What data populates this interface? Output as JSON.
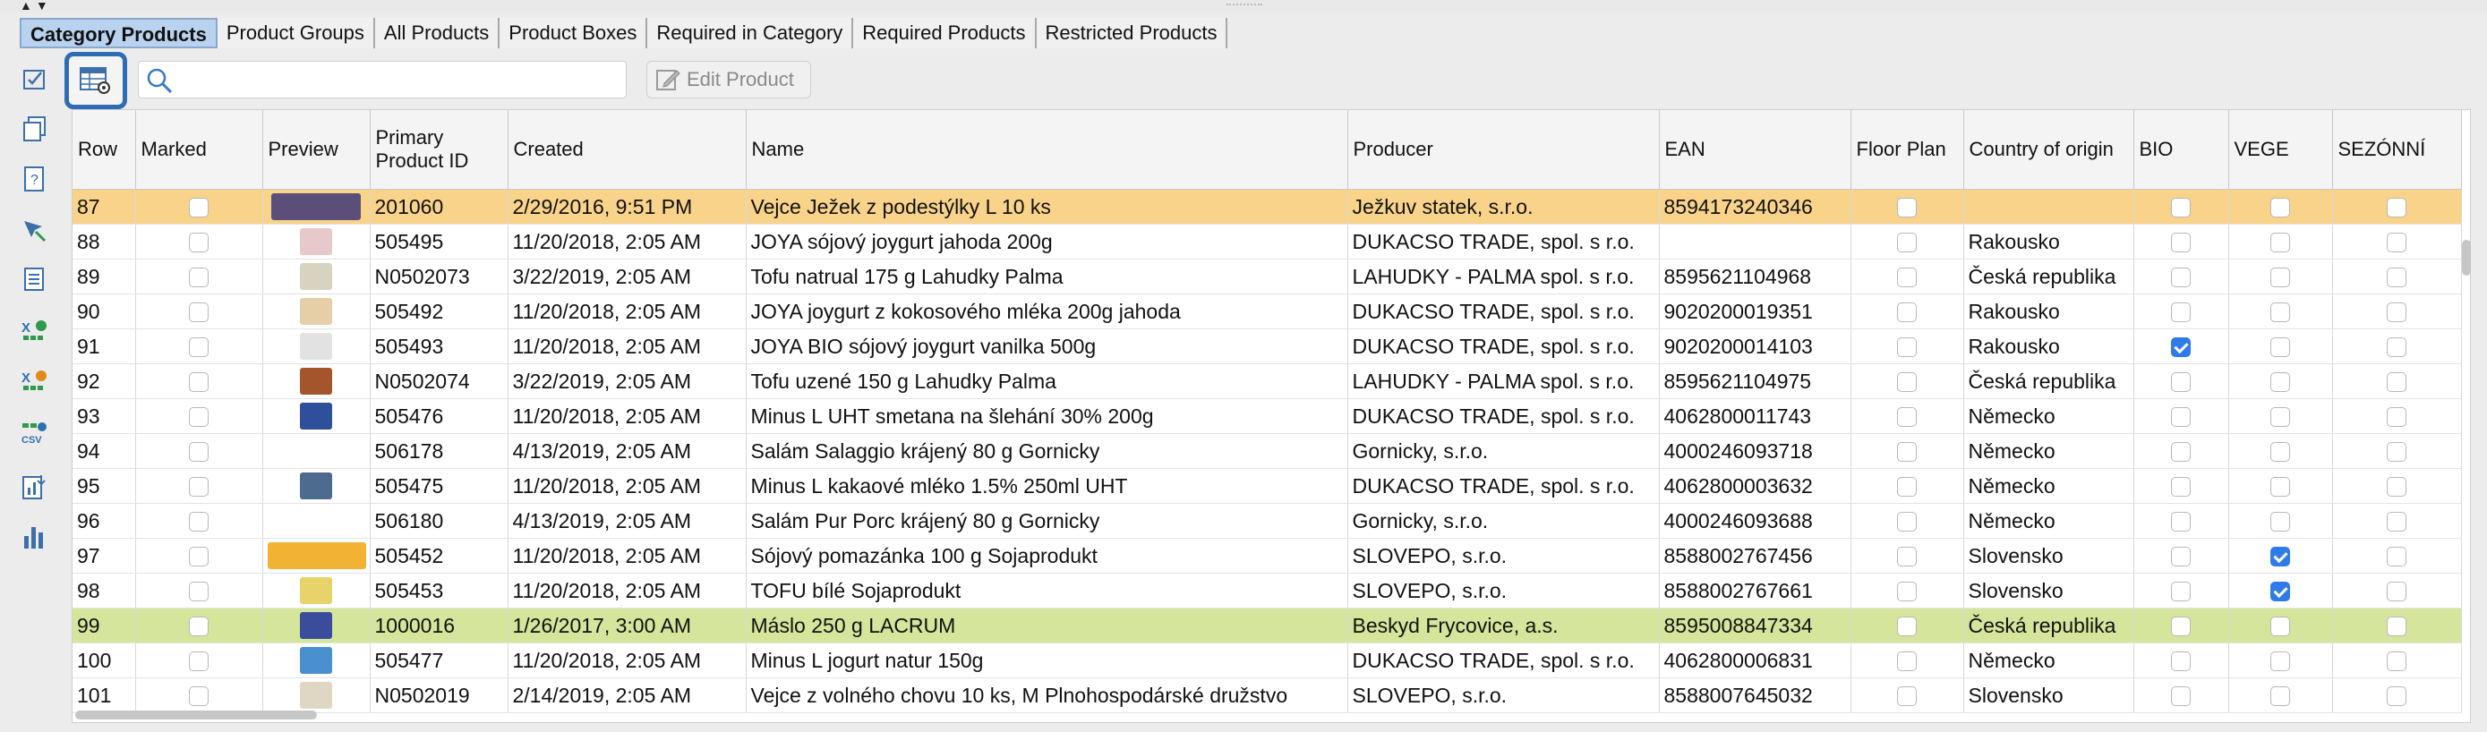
{
  "window": {
    "collapse_arrows": "▲▼"
  },
  "tabs": [
    {
      "label": "Category Products",
      "active": true
    },
    {
      "label": "Product Groups"
    },
    {
      "label": "All Products"
    },
    {
      "label": "Product Boxes"
    },
    {
      "label": "Required in Category"
    },
    {
      "label": "Required Products"
    },
    {
      "label": "Restricted Products"
    }
  ],
  "rail_icons": [
    "checklist-icon",
    "copy-icon",
    "help-list-icon",
    "move-icon",
    "list-icon",
    "export-xls-icon",
    "import-xls-icon",
    "export-csv-icon",
    "chart-sort-icon",
    "bar-chart-icon"
  ],
  "toolbar": {
    "search_placeholder": "",
    "search_value": "",
    "edit_label": "Edit Product"
  },
  "table": {
    "columns": [
      "Row",
      "Marked",
      "Preview",
      "Primary Product ID",
      "Created",
      "Name",
      "Producer",
      "EAN",
      "Floor Plan",
      "Country of origin",
      "BIO",
      "VEGE",
      "SEZÓNNÍ"
    ],
    "rows": [
      {
        "row": "87",
        "marked": false,
        "preview": "#5b4f7a",
        "id": "201060",
        "created": "2/29/2016, 9:51 PM",
        "name": "Vejce Ježek z podestýlky L 10 ks",
        "producer": "Ježkuv statek, s.r.o.",
        "ean": "8594173240346",
        "floor": false,
        "country": "",
        "bio": false,
        "vege": false,
        "sez": false,
        "highlight": "orange"
      },
      {
        "row": "88",
        "marked": false,
        "preview": "#e8c9c9",
        "id": "505495",
        "created": "11/20/2018, 2:05 AM",
        "name": "JOYA sójový joygurt jahoda 200g",
        "producer": "DUKACSO TRADE, spol. s r.o.",
        "ean": "",
        "floor": false,
        "country": "Rakousko",
        "bio": false,
        "vege": false,
        "sez": false
      },
      {
        "row": "89",
        "marked": false,
        "preview": "#d8d2c0",
        "id": "N0502073",
        "created": "3/22/2019, 2:05 AM",
        "name": "Tofu natrual 175 g Lahudky Palma",
        "producer": "LAHUDKY - PALMA spol. s r.o.",
        "ean": "8595621104968",
        "floor": false,
        "country": "Česká republika",
        "bio": false,
        "vege": false,
        "sez": false
      },
      {
        "row": "90",
        "marked": false,
        "preview": "#e6cfa8",
        "id": "505492",
        "created": "11/20/2018, 2:05 AM",
        "name": "JOYA joygurt z kokosového mléka 200g jahoda",
        "producer": "DUKACSO TRADE, spol. s r.o.",
        "ean": "9020200019351",
        "floor": false,
        "country": "Rakousko",
        "bio": false,
        "vege": false,
        "sez": false
      },
      {
        "row": "91",
        "marked": false,
        "preview": "#e2e2e2",
        "id": "505493",
        "created": "11/20/2018, 2:05 AM",
        "name": "JOYA BIO sójový joygurt vanilka 500g",
        "producer": "DUKACSO TRADE, spol. s r.o.",
        "ean": "9020200014103",
        "floor": false,
        "country": "Rakousko",
        "bio": true,
        "vege": false,
        "sez": false
      },
      {
        "row": "92",
        "marked": false,
        "preview": "#a5552b",
        "id": "N0502074",
        "created": "3/22/2019, 2:05 AM",
        "name": "Tofu uzené 150 g Lahudky Palma",
        "producer": "LAHUDKY - PALMA spol. s r.o.",
        "ean": "8595621104975",
        "floor": false,
        "country": "Česká republika",
        "bio": false,
        "vege": false,
        "sez": false
      },
      {
        "row": "93",
        "marked": false,
        "preview": "#2e4f9a",
        "id": "505476",
        "created": "11/20/2018, 2:05 AM",
        "name": "Minus L UHT smetana na šlehání 30% 200g",
        "producer": "DUKACSO TRADE, spol. s r.o.",
        "ean": "4062800011743",
        "floor": false,
        "country": "Německo",
        "bio": false,
        "vege": false,
        "sez": false
      },
      {
        "row": "94",
        "marked": false,
        "preview": "",
        "id": "506178",
        "created": "4/13/2019, 2:05 AM",
        "name": "Salám Salaggio krájený 80 g Gornicky",
        "producer": "Gornicky, s.r.o.",
        "ean": "4000246093718",
        "floor": false,
        "country": "Německo",
        "bio": false,
        "vege": false,
        "sez": false
      },
      {
        "row": "95",
        "marked": false,
        "preview": "#4d6a8f",
        "id": "505475",
        "created": "11/20/2018, 2:05 AM",
        "name": "Minus L kakaové mléko 1.5% 250ml UHT",
        "producer": "DUKACSO TRADE, spol. s r.o.",
        "ean": "4062800003632",
        "floor": false,
        "country": "Německo",
        "bio": false,
        "vege": false,
        "sez": false
      },
      {
        "row": "96",
        "marked": false,
        "preview": "",
        "id": "506180",
        "created": "4/13/2019, 2:05 AM",
        "name": "Salám Pur Porc krájený 80 g Gornicky",
        "producer": "Gornicky, s.r.o.",
        "ean": "4000246093688",
        "floor": false,
        "country": "Německo",
        "bio": false,
        "vege": false,
        "sez": false
      },
      {
        "row": "97",
        "marked": false,
        "preview": "#f2b233",
        "id": "505452",
        "created": "11/20/2018, 2:05 AM",
        "name": "Sójový pomazánka 100 g Sojaprodukt",
        "producer": "SLOVEPO, s.r.o.",
        "ean": "8588002767456",
        "floor": false,
        "country": "Slovensko",
        "bio": false,
        "vege": true,
        "sez": false
      },
      {
        "row": "98",
        "marked": false,
        "preview": "#e8d26a",
        "id": "505453",
        "created": "11/20/2018, 2:05 AM",
        "name": "TOFU bílé Sojaprodukt",
        "producer": "SLOVEPO, s.r.o.",
        "ean": "8588002767661",
        "floor": false,
        "country": "Slovensko",
        "bio": false,
        "vege": true,
        "sez": false
      },
      {
        "row": "99",
        "marked": false,
        "preview": "#3a4d9c",
        "id": "1000016",
        "created": "1/26/2017, 3:00 AM",
        "name": "Máslo 250 g LACRUM",
        "producer": "Beskyd Frycovice, a.s.",
        "ean": "8595008847334",
        "floor": false,
        "country": "Česká republika",
        "bio": false,
        "vege": false,
        "sez": false,
        "highlight": "green"
      },
      {
        "row": "100",
        "marked": false,
        "preview": "#4a8fd0",
        "id": "505477",
        "created": "11/20/2018, 2:05 AM",
        "name": "Minus L jogurt natur 150g",
        "producer": "DUKACSO TRADE, spol. s r.o.",
        "ean": "4062800006831",
        "floor": false,
        "country": "Německo",
        "bio": false,
        "vege": false,
        "sez": false
      },
      {
        "row": "101",
        "marked": false,
        "preview": "#e0d6c4",
        "id": "N0502019",
        "created": "2/14/2019, 2:05 AM",
        "name": "Vejce z volného chovu 10 ks, M Plnohospodárské  družstvo",
        "producer": "SLOVEPO, s.r.o.",
        "ean": "8588007645032",
        "floor": false,
        "country": "Slovensko",
        "bio": false,
        "vege": false,
        "sez": false
      }
    ]
  }
}
